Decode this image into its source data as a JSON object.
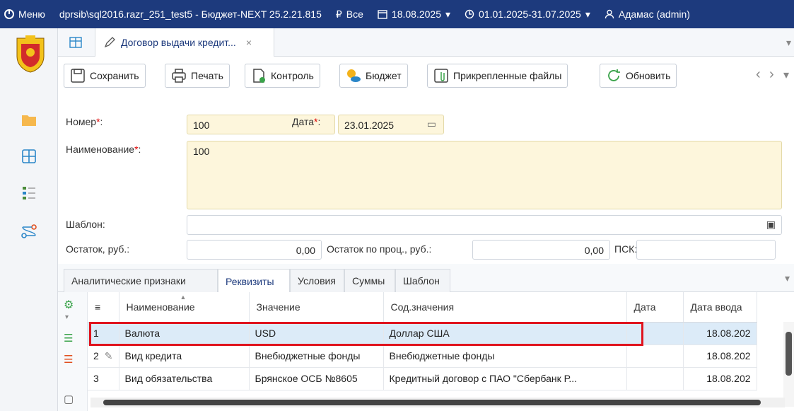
{
  "titlebar": {
    "menu": "Меню",
    "connection": "dprsib\\sql2016.razr_251_test5 - Бюджет-NEXT 25.2.21.815",
    "currency_filter": "Все",
    "date": "18.08.2025",
    "period": "01.01.2025-31.07.2025",
    "user": "Адамас (admin)"
  },
  "tabs": [
    {
      "label": "Договор выдачи кредит...",
      "close": "×"
    }
  ],
  "toolbar": {
    "save": "Сохранить",
    "print": "Печать",
    "control": "Контроль",
    "budget": "Бюджет",
    "attachments": "Прикрепленные файлы",
    "refresh": "Обновить"
  },
  "form": {
    "number_label": "Номер",
    "number_value": "100",
    "date_label": "Дата",
    "date_value": "23.01.2025",
    "name_label": "Наименование",
    "name_value": "100",
    "template_label": "Шаблон:",
    "balance_label": "Остаток, руб.:",
    "balance_value": "0,00",
    "interest_label": "Остаток по проц., руб.:",
    "interest_value": "0,00",
    "psk_label": "ПСК:"
  },
  "subtabs": [
    "Аналитические признаки",
    "Реквизиты",
    "Условия",
    "Суммы",
    "Шаблон"
  ],
  "active_subtab": "Реквизиты",
  "table": {
    "columns": [
      "Наименование",
      "Значение",
      "Сод.значения",
      "Дата",
      "Дата ввода"
    ],
    "rows": [
      {
        "num": "1",
        "name": "Валюта",
        "value": "USD",
        "content": "Доллар США",
        "date": "",
        "input_date": "18.08.202"
      },
      {
        "num": "2",
        "name": "Вид кредита",
        "value": "Внебюджетные фонды",
        "content": "Внебюджетные фонды",
        "date": "",
        "input_date": "18.08.202"
      },
      {
        "num": "3",
        "name": "Вид обязательства",
        "value": "Брянское ОСБ №8605",
        "content": "Кредитный договор с ПАО \"Сбербанк Р...",
        "date": "",
        "input_date": "18.08.202"
      }
    ]
  },
  "colors": {
    "titlebar": "#1d3a7d",
    "selected_row": "#dcebf8",
    "highlight": "#e0141e",
    "required_field": "#fdf6dc"
  }
}
